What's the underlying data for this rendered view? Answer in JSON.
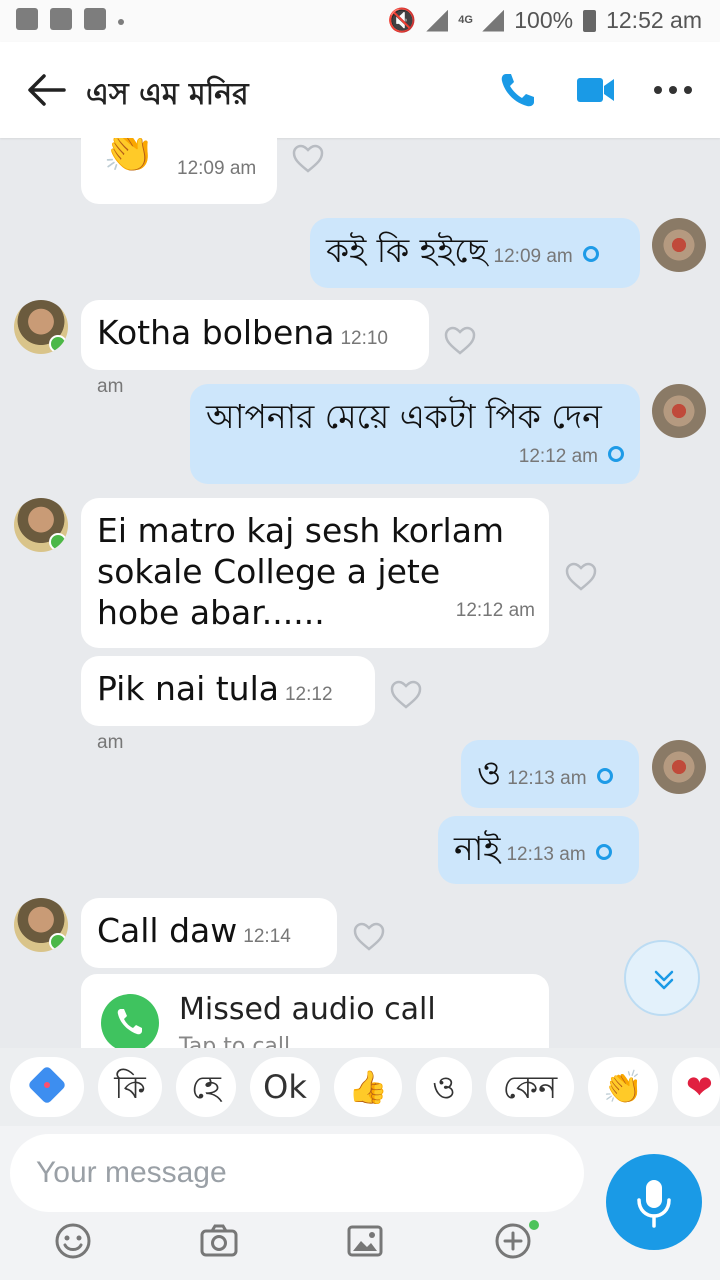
{
  "status_bar": {
    "battery": "100%",
    "time": "12:52 am",
    "network": "4G"
  },
  "header": {
    "contact_name": "এস এম মনির"
  },
  "messages": [
    {
      "emoji": "👏",
      "time": "12:09 am"
    },
    {
      "text": "কই কি হইছে",
      "time": "12:09 am"
    },
    {
      "text": "Kotha bolbena",
      "time": "12:10 am"
    },
    {
      "text": "আপনার মেয়ে একটা পিক দেন",
      "time": "12:12 am"
    },
    {
      "text": "Ei matro kaj sesh korlam sokale College a jete hobe abar......",
      "time": "12:12 am"
    },
    {
      "text": "Pik nai tula",
      "time": "12:12 am"
    },
    {
      "text": "ও",
      "time": "12:13 am"
    },
    {
      "text": "নাই",
      "time": "12:13 am"
    },
    {
      "text": "Call daw",
      "time": "12:14 am"
    }
  ],
  "call_card": {
    "title": "Missed audio call",
    "subtitle": "Tap to call"
  },
  "quick_replies": [
    "কি",
    "হে",
    "Ok",
    "👍",
    "ও",
    "কেন",
    "👏",
    "❤"
  ],
  "composer": {
    "placeholder": "Your message"
  },
  "colors": {
    "accent": "#1a9ae6",
    "outgoing_bubble": "#cde6fb",
    "incoming_bubble": "#ffffff",
    "background": "#e8eaed"
  }
}
